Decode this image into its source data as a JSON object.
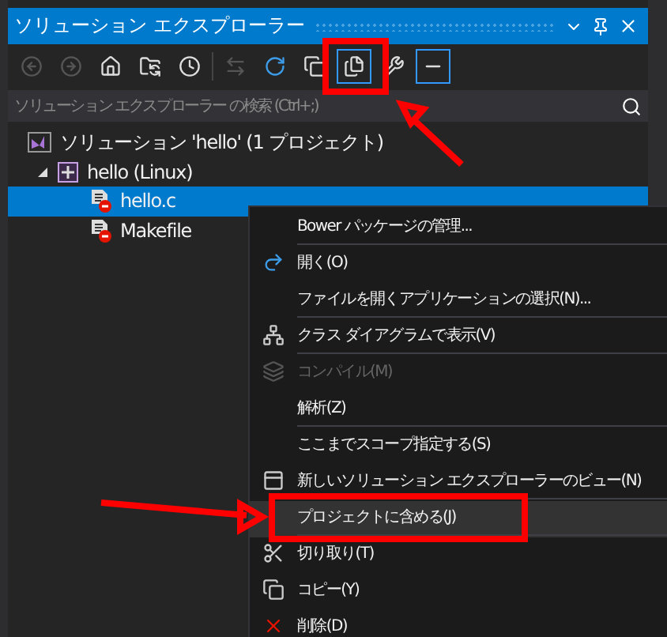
{
  "window": {
    "title": "ソリューション エクスプローラー"
  },
  "toolbar": {
    "buttons": [
      {
        "disabled": true,
        "selected": false
      },
      {
        "disabled": true,
        "selected": false
      },
      {
        "disabled": false,
        "selected": false
      },
      {
        "disabled": false,
        "selected": false
      },
      {
        "disabled": false,
        "selected": false
      },
      {
        "disabled": true,
        "selected": false
      },
      {
        "disabled": false,
        "selected": false
      },
      {
        "disabled": false,
        "selected": false
      },
      {
        "disabled": false,
        "selected": true
      },
      {
        "disabled": false,
        "selected": false
      },
      {
        "disabled": false,
        "selected": true
      }
    ]
  },
  "search": {
    "placeholder": "ソリューション エクスプローラー の検索 (Ctrl+;)"
  },
  "tree": [
    {
      "kind": "solution",
      "label": "ソリューション 'hello' (1 プロジェクト)",
      "selected": false,
      "children": [
        {
          "kind": "project",
          "label": "hello (Linux)",
          "selected": false,
          "expanded": true,
          "children": [
            {
              "kind": "file",
              "label": "hello.c",
              "selected": true
            },
            {
              "kind": "file",
              "label": "Makefile",
              "selected": false
            }
          ]
        }
      ]
    }
  ],
  "context_menu": {
    "items": [
      {
        "label": "Bower パッケージの管理...",
        "disabled": false,
        "selected": false,
        "separator_after": true
      },
      {
        "label": "開く(O)",
        "disabled": false,
        "selected": false,
        "separator_after": false
      },
      {
        "label": "ファイルを開くアプリケーションの選択(N)...",
        "disabled": false,
        "selected": false,
        "separator_after": true
      },
      {
        "label": "クラス ダイアグラムで表示(V)",
        "disabled": false,
        "selected": false,
        "separator_after": true
      },
      {
        "label": "コンパイル(M)",
        "disabled": true,
        "selected": false,
        "separator_after": false
      },
      {
        "label": "解析(Z)",
        "disabled": false,
        "selected": false,
        "separator_after": true
      },
      {
        "label": "ここまでスコープ指定する(S)",
        "disabled": false,
        "selected": false,
        "separator_after": false
      },
      {
        "label": "新しいソリューション エクスプローラーのビュー(N)",
        "disabled": false,
        "selected": false,
        "separator_after": true
      },
      {
        "label": "プロジェクトに含める(J)",
        "disabled": false,
        "selected": true,
        "separator_after": true
      },
      {
        "label": "切り取り(T)",
        "disabled": false,
        "selected": false,
        "separator_after": false
      },
      {
        "label": "コピー(Y)",
        "disabled": false,
        "selected": false,
        "separator_after": false
      },
      {
        "label": "削除(D)",
        "disabled": false,
        "selected": false
      }
    ]
  }
}
